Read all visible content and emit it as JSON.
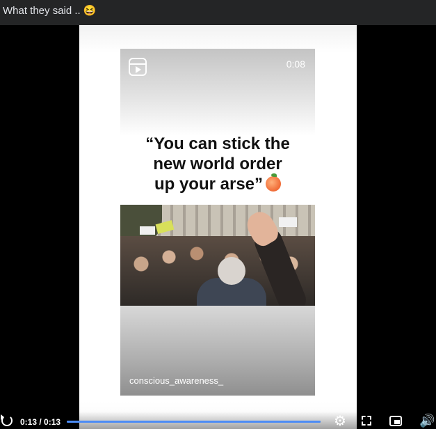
{
  "post": {
    "text": "What they said ..",
    "emoji": "😆"
  },
  "reel": {
    "timestamp": "0:08",
    "quote_line1": "“You can stick the",
    "quote_line2": "new world order",
    "quote_line3": "up your arse”",
    "handle": "conscious_awareness_"
  },
  "player": {
    "time": "0:13 / 0:13",
    "progress": 1.0,
    "accent_color": "#4c8cf5",
    "icons": [
      "replay-icon",
      "settings-icon",
      "fullscreen-icon",
      "picture-in-picture-icon",
      "volume-icon"
    ]
  }
}
